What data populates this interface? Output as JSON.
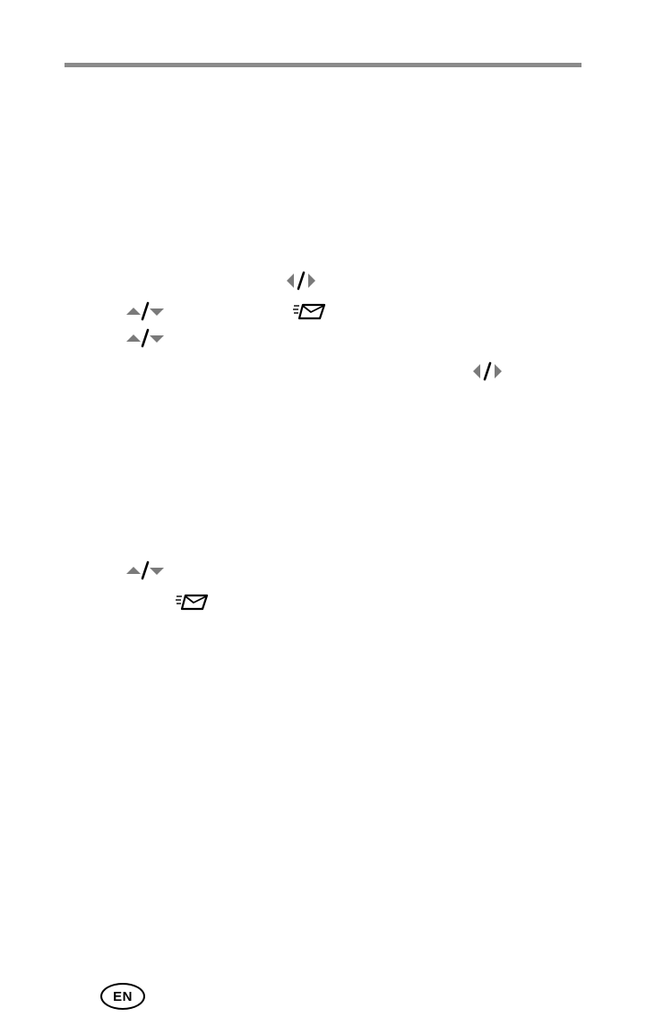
{
  "page": {
    "language_badge": "EN"
  },
  "icons": {
    "left_right": "left-right-arrows-icon",
    "up_down": "up-down-arrows-icon",
    "share": "share-email-icon"
  },
  "colors": {
    "rule": "#8a8a8a",
    "arrow": "#7a7a7a",
    "ink": "#000000"
  }
}
